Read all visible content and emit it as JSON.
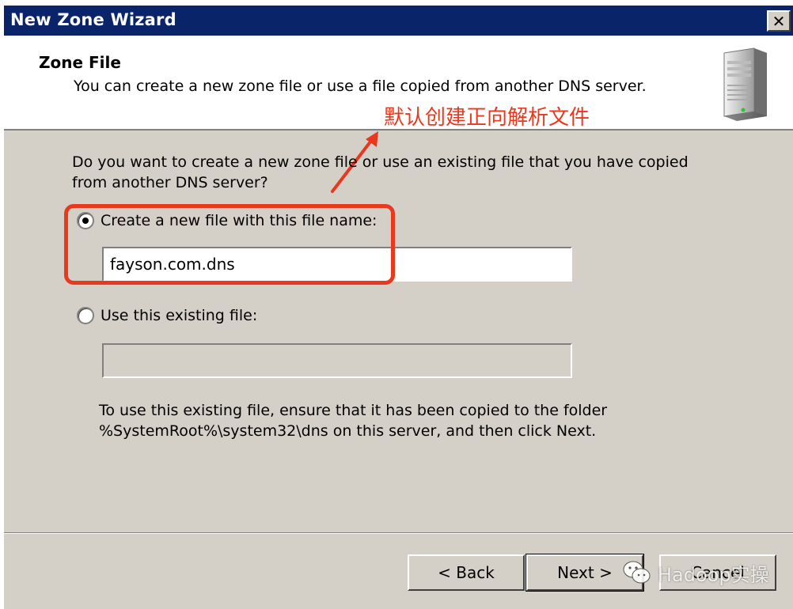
{
  "window": {
    "title": "New Zone Wizard",
    "close_label": "✕"
  },
  "header": {
    "title": "Zone File",
    "subtitle": "You can create a new zone file or use a file copied from another DNS server.",
    "icon": "server-icon"
  },
  "annotation": {
    "text": "默认创建正向解析文件",
    "color": "#e8391e"
  },
  "body": {
    "question": "Do you want to create a new zone file or use an existing file that you have copied from another DNS server?",
    "options": [
      {
        "label": "Create a new file with this file name:",
        "selected": true,
        "value": "fayson.com.dns"
      },
      {
        "label": "Use this existing file:",
        "selected": false,
        "value": ""
      }
    ],
    "info": "To use this existing file, ensure that it has been copied to the folder %SystemRoot%\\system32\\dns on this server, and then click Next."
  },
  "buttons": {
    "back": "< Back",
    "next": "Next >",
    "cancel": "Cancel"
  },
  "watermark": {
    "text": "Hadoop实操",
    "icon": "wechat-icon"
  },
  "colors": {
    "titlebar": "#0a246a",
    "dialog_bg": "#d4d0c8",
    "annotation": "#e8391e"
  }
}
